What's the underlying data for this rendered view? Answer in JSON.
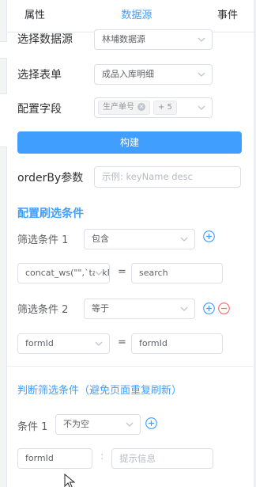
{
  "tabs": [
    {
      "label": "属性",
      "active": false
    },
    {
      "label": "数据源",
      "active": true
    },
    {
      "label": "事件",
      "active": false
    }
  ],
  "form": {
    "datasource_label": "选择数据源",
    "datasource_value": "林埔数据源",
    "table_label": "选择表单",
    "table_value": "成品入库明细",
    "fields_label": "配置字段",
    "fields_tags": [
      "生产单号",
      "+ 5"
    ],
    "build_label": "构建",
    "orderby_label": "orderBy参数",
    "orderby_placeholder": "示例: keyName desc"
  },
  "filter_section": {
    "title": "配置刷选条件",
    "conditions": [
      {
        "label": "筛选条件 1",
        "operator": "包含",
        "field": "concat_ws(\"\",`taskN",
        "equals": "=",
        "value": "search"
      },
      {
        "label": "筛选条件 2",
        "operator": "等于",
        "field": "formId",
        "equals": "=",
        "value": "formId"
      }
    ]
  },
  "judge_section": {
    "title": "判断筛选条件（避免页面重复刷新）",
    "condition_label": "条件 1",
    "condition_operator": "不为空",
    "field_value": "formId",
    "colon": ":",
    "message_placeholder": "提示信息"
  },
  "colors": {
    "accent": "#409eff",
    "danger": "#f56c6c",
    "border": "#dcdfe6"
  }
}
